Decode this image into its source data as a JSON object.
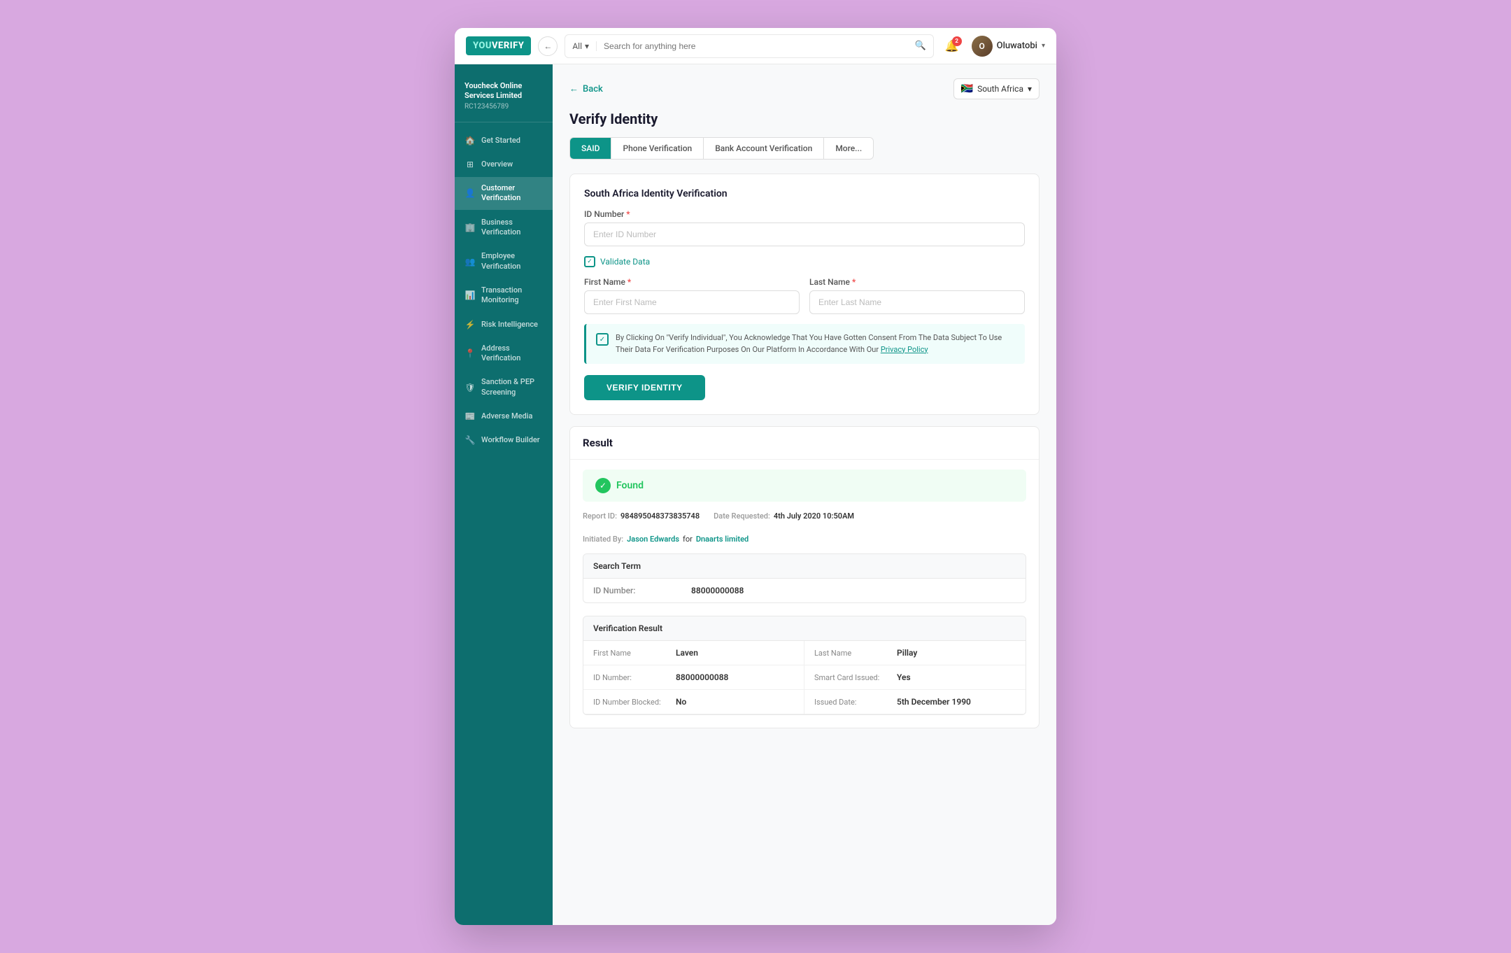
{
  "topbar": {
    "logo_you": "YOU",
    "logo_verify": "VERIFY",
    "back_btn_label": "←",
    "search_filter": "All",
    "search_placeholder": "Search for anything here",
    "notification_count": "2",
    "user_name": "Oluwatobi",
    "user_initials": "O"
  },
  "org": {
    "name": "Youcheck Online Services Limited",
    "rc": "RC123456789"
  },
  "nav": {
    "items": [
      {
        "id": "get-started",
        "label": "Get Started",
        "icon": "🏠"
      },
      {
        "id": "overview",
        "label": "Overview",
        "icon": "⊞"
      },
      {
        "id": "customer-verification",
        "label": "Customer Verification",
        "icon": "👤",
        "active": true
      },
      {
        "id": "business-verification",
        "label": "Business Verification",
        "icon": "🏢"
      },
      {
        "id": "employee-verification",
        "label": "Employee Verification",
        "icon": "👥"
      },
      {
        "id": "transaction-monitoring",
        "label": "Transaction Monitoring",
        "icon": "📊"
      },
      {
        "id": "risk-intelligence",
        "label": "Risk Intelligence",
        "icon": "⚡"
      },
      {
        "id": "address-verification",
        "label": "Address Verification",
        "icon": "📍"
      },
      {
        "id": "sanction-pep",
        "label": "Sanction & PEP Screening",
        "icon": "🛡"
      },
      {
        "id": "adverse-media",
        "label": "Adverse Media",
        "icon": "📰"
      },
      {
        "id": "workflow-builder",
        "label": "Workflow Builder",
        "icon": "🔧"
      }
    ]
  },
  "page": {
    "back_label": "Back",
    "title": "Verify Identity",
    "country": "South Africa",
    "country_flag": "🇿🇦"
  },
  "tabs": [
    {
      "id": "said",
      "label": "SAID",
      "active": true
    },
    {
      "id": "phone",
      "label": "Phone Verification",
      "active": false
    },
    {
      "id": "bank",
      "label": "Bank Account Verification",
      "active": false
    },
    {
      "id": "more",
      "label": "More...",
      "active": false
    }
  ],
  "form": {
    "section_title": "South Africa Identity Verification",
    "id_number_label": "ID Number",
    "id_number_placeholder": "Enter ID Number",
    "validate_label": "Validate Data",
    "first_name_label": "First Name",
    "first_name_placeholder": "Enter First Name",
    "last_name_label": "Last Name",
    "last_name_placeholder": "Enter Last Name",
    "consent_text": "By Clicking On \"Verify Individual\", You Acknowledge That You Have Gotten Consent From The Data Subject To Use Their Data For Verification Purposes On Our Platform In Accordance With Our ",
    "consent_link": "Privacy Policy",
    "verify_btn": "VERIFY IDENTITY"
  },
  "result": {
    "title": "Result",
    "status": "Found",
    "report_id_label": "Report ID:",
    "report_id_value": "984895048373835748",
    "date_requested_label": "Date Requested:",
    "date_requested_value": "4th July 2020 10:50AM",
    "initiated_by_label": "Initiated By:",
    "initiated_by_name": "Jason Edwards",
    "initiated_by_for": "for",
    "initiated_by_org": "Dnaarts limited",
    "search_term_header": "Search Term",
    "id_number_field": "ID Number:",
    "id_number_result": "88000000088",
    "verification_header": "Verification Result",
    "fields": [
      {
        "label": "First Name",
        "value": "Laven"
      },
      {
        "label": "Last Name",
        "value": "Pillay"
      },
      {
        "label": "ID Number:",
        "value": "88000000088"
      },
      {
        "label": "Smart Card Issued:",
        "value": "Yes"
      },
      {
        "label": "ID Number Blocked:",
        "value": "No"
      },
      {
        "label": "Issued Date:",
        "value": "5th December 1990"
      }
    ]
  }
}
